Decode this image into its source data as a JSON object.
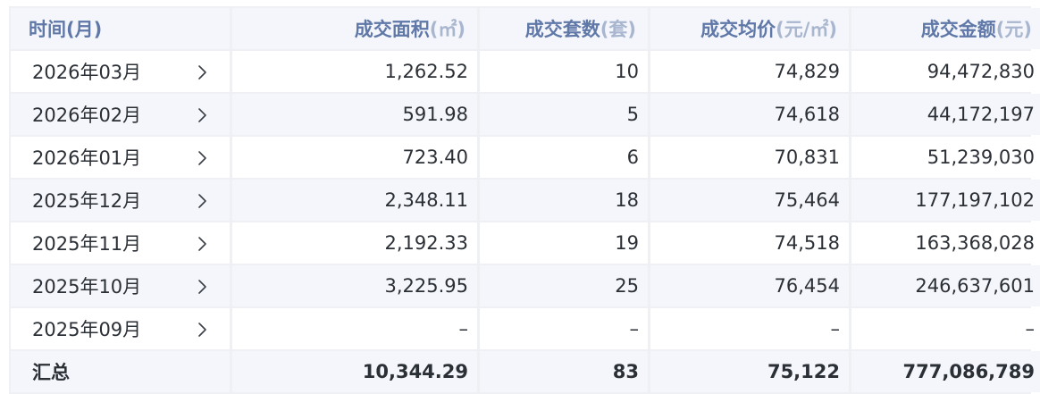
{
  "header": {
    "time": "时间(月)",
    "area": {
      "main": "成交面积",
      "unit": "(㎡)"
    },
    "units": {
      "main": "成交套数",
      "unit": "(套)"
    },
    "avg_price": {
      "main": "成交均价",
      "unit": "(元/㎡)"
    },
    "amount": {
      "main": "成交金额",
      "unit": "(元)"
    }
  },
  "rows": [
    {
      "month": "2026年03月",
      "area": "1,262.52",
      "units": "10",
      "avg_price": "74,829",
      "amount": "94,472,830"
    },
    {
      "month": "2026年02月",
      "area": "591.98",
      "units": "5",
      "avg_price": "74,618",
      "amount": "44,172,197"
    },
    {
      "month": "2026年01月",
      "area": "723.40",
      "units": "6",
      "avg_price": "70,831",
      "amount": "51,239,030"
    },
    {
      "month": "2025年12月",
      "area": "2,348.11",
      "units": "18",
      "avg_price": "75,464",
      "amount": "177,197,102"
    },
    {
      "month": "2025年11月",
      "area": "2,192.33",
      "units": "19",
      "avg_price": "74,518",
      "amount": "163,368,028"
    },
    {
      "month": "2025年10月",
      "area": "3,225.95",
      "units": "25",
      "avg_price": "76,454",
      "amount": "246,637,601"
    },
    {
      "month": "2025年09月",
      "area": "–",
      "units": "–",
      "avg_price": "–",
      "amount": "–"
    }
  ],
  "total": {
    "label": "汇总",
    "area": "10,344.29",
    "units": "83",
    "avg_price": "75,122",
    "amount": "777,086,789"
  },
  "colors": {
    "header_text": "#5f78a8",
    "unit_text": "#a9b6cf",
    "stripe": "#f4f6fb",
    "border": "#eef0f4"
  },
  "icons": {
    "row_expand": "chevron-right-icon"
  }
}
